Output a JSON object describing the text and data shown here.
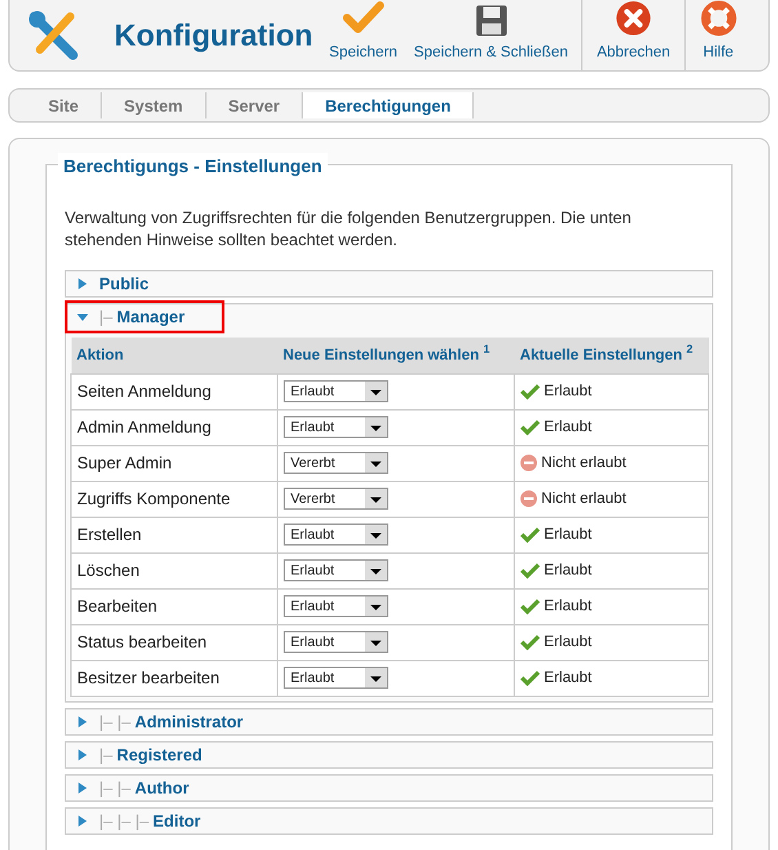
{
  "toolbar": {
    "title": "Konfiguration",
    "buttons": [
      {
        "kind": "save",
        "label": "Speichern"
      },
      {
        "kind": "save_close",
        "label": "Speichern & Schließen"
      },
      {
        "kind": "cancel",
        "label": "Abbrechen"
      },
      {
        "kind": "help",
        "label": "Hilfe"
      }
    ]
  },
  "tabs": [
    {
      "label": "Site",
      "selected": false
    },
    {
      "label": "System",
      "selected": false
    },
    {
      "label": "Server",
      "selected": false
    },
    {
      "label": "Berechtigungen",
      "selected": true
    }
  ],
  "fieldset": {
    "legend": "Berechtigungs - Einstellungen",
    "description": "Verwaltung von Zugriffsrechten für die folgenden Benutzergruppen. Die unten stehenden Hinweise sollten beachtet werden.",
    "groups": [
      {
        "name": "Public",
        "expanded": false,
        "highlighted": false
      },
      {
        "prefix": "|–",
        "name": "Manager",
        "expanded": true,
        "highlighted": true,
        "table": {
          "columns": [
            "Aktion",
            "Neue Einstellungen wählen $^{1}$",
            "Aktuelle Einstellungen $^{2}$"
          ],
          "rows": [
            {
              "action": "Seiten Anmeldung",
              "setting": "Erlaubt",
              "current": "Erlaubt",
              "allowed": true
            },
            {
              "action": "Admin Anmeldung",
              "setting": "Erlaubt",
              "current": "Erlaubt",
              "allowed": true
            },
            {
              "action": "Super Admin",
              "setting": "Vererbt",
              "current": "Nicht erlaubt",
              "allowed": false
            },
            {
              "action": "Zugriffs Komponente",
              "setting": "Vererbt",
              "current": "Nicht erlaubt",
              "allowed": false
            },
            {
              "action": "Erstellen",
              "setting": "Erlaubt",
              "current": "Erlaubt",
              "allowed": true
            },
            {
              "action": "Löschen",
              "setting": "Erlaubt",
              "current": "Erlaubt",
              "allowed": true
            },
            {
              "action": "Bearbeiten",
              "setting": "Erlaubt",
              "current": "Erlaubt",
              "allowed": true
            },
            {
              "action": "Status bearbeiten",
              "setting": "Erlaubt",
              "current": "Erlaubt",
              "allowed": true
            },
            {
              "action": "Besitzer bearbeiten",
              "setting": "Erlaubt",
              "current": "Erlaubt",
              "allowed": true
            }
          ]
        }
      },
      {
        "prefix": "|– |–",
        "name": "Administrator",
        "expanded": false,
        "highlighted": false
      },
      {
        "prefix": "|–",
        "name": "Registered",
        "expanded": false,
        "highlighted": false
      },
      {
        "prefix": "|– |–",
        "name": "Author",
        "expanded": false,
        "highlighted": false
      },
      {
        "prefix": "|– |– |–",
        "name": "Editor",
        "expanded": false,
        "highlighted": false
      }
    ]
  }
}
